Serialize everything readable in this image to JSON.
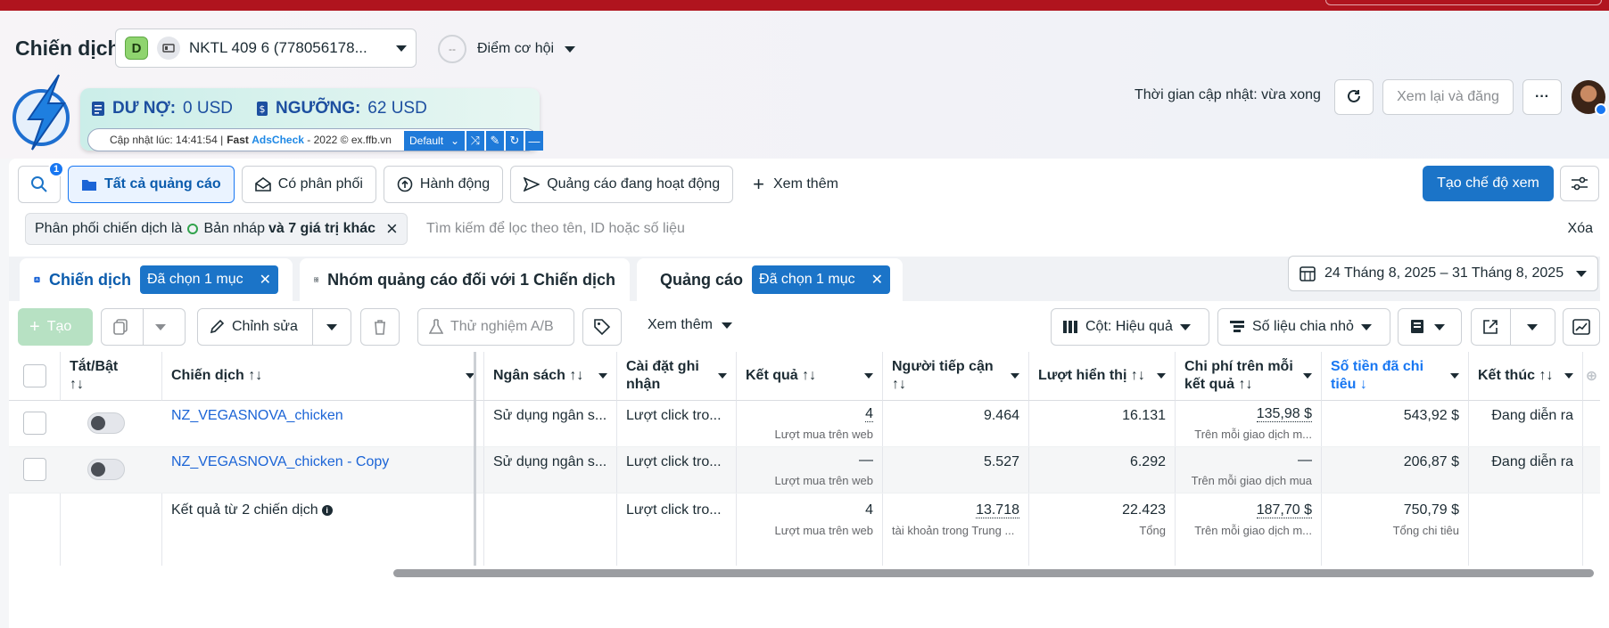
{
  "header": {
    "title": "Chiến dịch",
    "account": {
      "badge": "D",
      "name": "NKTL 409 6 (778056178..."
    },
    "opportunity": {
      "score": "--",
      "label": "Điểm cơ hội"
    },
    "update_time": "Thời gian cập nhật: vừa xong",
    "review_button": "Xem lại và đăng",
    "more_button": "···"
  },
  "extension": {
    "debt_label": "DƯ NỢ:",
    "debt_value": "0 USD",
    "threshold_label": "NGƯỠNG:",
    "threshold_value": "62 USD",
    "updated_at": "Cập nhật lúc: 14:41:54 |",
    "brand_fast": "Fast",
    "brand_ads": "AdsCheck",
    "credit": "- 2022 © ex.ffb.vn",
    "preset": "Default"
  },
  "toolbar1": {
    "search_badge": "1",
    "all_ads": "Tất cả quảng cáo",
    "delivered": "Có phân phối",
    "actions": "Hành động",
    "active_ads": "Quảng cáo đang hoạt động",
    "see_more": "Xem thêm",
    "create_view": "Tạo chế độ xem"
  },
  "filter": {
    "chip_prefix": "Phân phối chiến dịch là",
    "chip_value": "Bản nháp",
    "chip_more": "và 7 giá trị khác",
    "placeholder": "Tìm kiếm để lọc theo tên, ID hoặc số liệu",
    "clear": "Xóa"
  },
  "tabs": {
    "campaigns": "Chiến dịch",
    "campaigns_selected": "Đã chọn 1 mục",
    "adsets": "Nhóm quảng cáo đối với 1 Chiến dịch",
    "ads": "Quảng cáo",
    "ads_selected": "Đã chọn 1 mục",
    "date_range": "24 Tháng 8, 2025 – 31 Tháng 8, 2025"
  },
  "toolbar2": {
    "create": "Tạo",
    "edit": "Chỉnh sửa",
    "ab_test": "Thử nghiệm A/B",
    "see_more": "Xem thêm",
    "columns": "Cột: Hiệu quả",
    "breakdown": "Số liệu chia nhỏ"
  },
  "table": {
    "headers": {
      "toggle": "Tắt/Bật",
      "campaign": "Chiến dịch",
      "budget": "Ngân sách",
      "attribution": "Cài đặt ghi nhận",
      "results": "Kết quả",
      "reach": "Người tiếp cận",
      "impressions": "Lượt hiển thị",
      "cost_per_result": "Chi phí trên mỗi kết quả",
      "amount_spent": "Số tiền đã chi tiêu",
      "ends": "Kết thúc"
    },
    "sort_icon": "↑↓",
    "sort_desc_icon": "↓",
    "rows": [
      {
        "name": "NZ_VEGASNOVA_chicken",
        "budget": "Sử dụng ngân s...",
        "attribution": "Lượt click tro...",
        "results": "4",
        "results_sub": "Lượt mua trên web",
        "reach": "9.464",
        "impressions": "16.131",
        "cpr": "135,98 $",
        "cpr_sub": "Trên mỗi giao dịch m...",
        "spent": "543,92 $",
        "ends": "Đang diễn ra"
      },
      {
        "name": "NZ_VEGASNOVA_chicken - Copy",
        "budget": "Sử dụng ngân s...",
        "attribution": "Lượt click tro...",
        "results": "—",
        "results_sub": "Lượt mua trên web",
        "reach": "5.527",
        "impressions": "6.292",
        "cpr": "—",
        "cpr_sub": "Trên mỗi giao dịch mua",
        "spent": "206,87 $",
        "ends": "Đang diễn ra"
      }
    ],
    "summary": {
      "label": "Kết quả từ 2 chiến dịch",
      "attribution": "Lượt click tro...",
      "results": "4",
      "results_sub": "Lượt mua trên web",
      "reach": "13.718",
      "reach_sub": "tài khoản trong Trung ...",
      "impressions": "22.423",
      "impressions_sub": "Tổng",
      "cpr": "187,70 $",
      "cpr_sub": "Trên mỗi giao dịch m...",
      "spent": "750,79 $",
      "spent_sub": "Tổng chi tiêu"
    }
  }
}
